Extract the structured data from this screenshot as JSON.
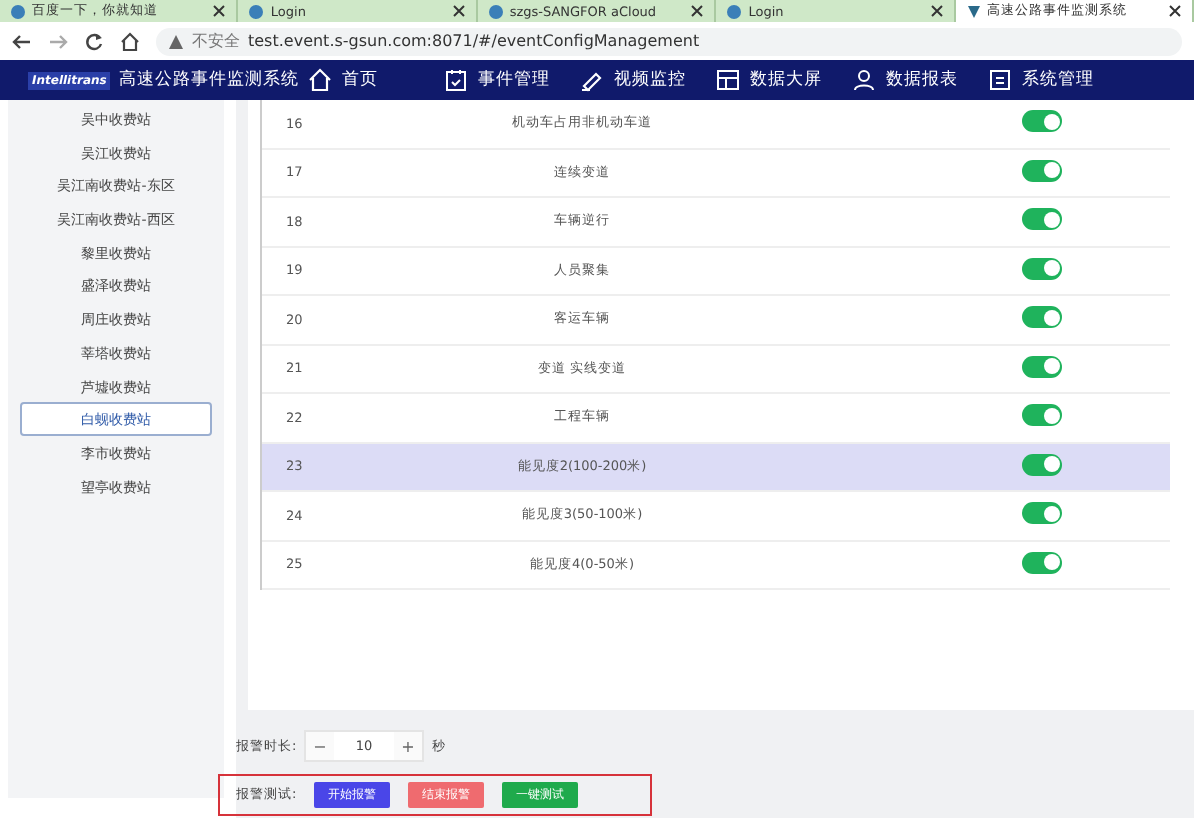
{
  "browser": {
    "tabs": [
      {
        "title": "百度一下，你就知道",
        "selected": false
      },
      {
        "title": "Login",
        "selected": false
      },
      {
        "title": "szgs-SANGFOR aCloud",
        "selected": false
      },
      {
        "title": "Login",
        "selected": false
      },
      {
        "title": "高速公路事件监测系统",
        "selected": true
      }
    ],
    "security": "不安全",
    "url": "test.event.s-gsun.com:8071/#/eventConfigManagement"
  },
  "app": {
    "logo": "Intellitrans",
    "title": "高速公路事件监测系统",
    "nav": [
      {
        "label": "首页",
        "kind": "home"
      },
      {
        "label": "事件管理",
        "kind": "event"
      },
      {
        "label": "视频监控",
        "kind": "video"
      },
      {
        "label": "数据大屏",
        "kind": "screen"
      },
      {
        "label": "数据报表",
        "kind": "report"
      },
      {
        "label": "系统管理",
        "kind": "system"
      }
    ]
  },
  "sidebar": {
    "items": [
      {
        "label": "吴中收费站",
        "selected": false
      },
      {
        "label": "吴江收费站",
        "selected": false
      },
      {
        "label": "吴江南收费站-东区",
        "selected": false
      },
      {
        "label": "吴江南收费站-西区",
        "selected": false
      },
      {
        "label": "黎里收费站",
        "selected": false
      },
      {
        "label": "盛泽收费站",
        "selected": false
      },
      {
        "label": "周庄收费站",
        "selected": false
      },
      {
        "label": "莘塔收费站",
        "selected": false
      },
      {
        "label": "芦墟收费站",
        "selected": false
      },
      {
        "label": "白蚬收费站",
        "selected": true
      },
      {
        "label": "李市收费站",
        "selected": false
      },
      {
        "label": "望亭收费站",
        "selected": false
      }
    ]
  },
  "table": {
    "rows": [
      {
        "number": "16",
        "name": "机动车占用非机动车道",
        "on": true,
        "selected": false
      },
      {
        "number": "17",
        "name": "连续变道",
        "on": true,
        "selected": false
      },
      {
        "number": "18",
        "name": "车辆逆行",
        "on": true,
        "selected": false
      },
      {
        "number": "19",
        "name": "人员聚集",
        "on": true,
        "selected": false
      },
      {
        "number": "20",
        "name": "客运车辆",
        "on": true,
        "selected": false
      },
      {
        "number": "21",
        "name": "变道 实线变道",
        "on": true,
        "selected": false
      },
      {
        "number": "22",
        "name": "工程车辆",
        "on": true,
        "selected": false
      },
      {
        "number": "23",
        "name": "能见度2(100-200米)",
        "on": true,
        "selected": true
      },
      {
        "number": "24",
        "name": "能见度3(50-100米)",
        "on": true,
        "selected": false
      },
      {
        "number": "25",
        "name": "能见度4(0-50米)",
        "on": true,
        "selected": false
      }
    ]
  },
  "alarm_duration": {
    "label": "报警时长:",
    "minus": "−",
    "value": "10",
    "plus": "+",
    "unit": "秒"
  },
  "alarm_test": {
    "label": "报警测试:",
    "highlighted": true,
    "buttons": [
      {
        "label": "开始报警",
        "kind": "start"
      },
      {
        "label": "结束报警",
        "kind": "stop"
      },
      {
        "label": "一键测试",
        "kind": "test"
      }
    ]
  }
}
